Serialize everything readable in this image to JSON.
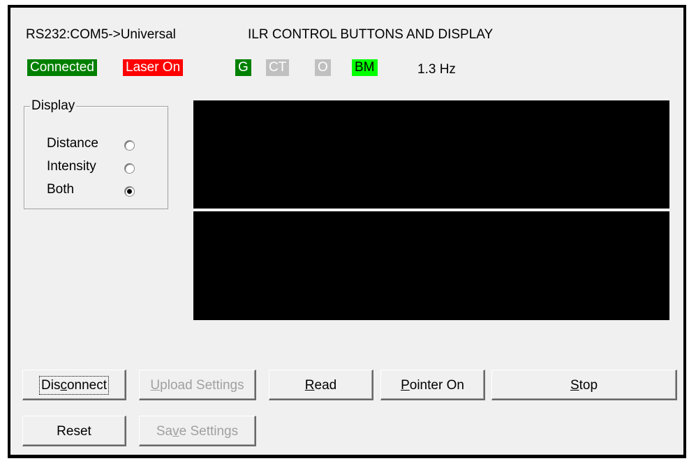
{
  "header": {
    "connection_info": "RS232:COM5->Universal",
    "title": "ILR CONTROL BUTTONS AND DISPLAY",
    "frequency": "1.3 Hz"
  },
  "status": {
    "connected": {
      "label": "Connected",
      "bg": "#008000",
      "fg": "#ffffff"
    },
    "laser": {
      "label": "Laser On",
      "bg": "#ff0000",
      "fg": "#ffffff"
    },
    "g": {
      "label": "G",
      "bg": "#008000",
      "fg": "#ffffff"
    },
    "ct": {
      "label": "CT",
      "bg": "#c0c0c0",
      "fg": "#ffffff"
    },
    "o": {
      "label": "O",
      "bg": "#c0c0c0",
      "fg": "#ffffff"
    },
    "bm": {
      "label": "BM",
      "bg": "#00ff00",
      "fg": "#000000"
    }
  },
  "display_group": {
    "title": "Display",
    "options": [
      {
        "label": "Distance",
        "selected": false
      },
      {
        "label": "Intensity",
        "selected": false
      },
      {
        "label": "Both",
        "selected": true
      }
    ]
  },
  "buttons": {
    "disconnect": {
      "pre": "Dis",
      "ul": "c",
      "post": "onnect"
    },
    "upload": {
      "pre": "",
      "ul": "U",
      "post": "pload Settings"
    },
    "read": {
      "pre": "",
      "ul": "R",
      "post": "ead"
    },
    "pointer": {
      "pre": "",
      "ul": "P",
      "post": "ointer On"
    },
    "stop": {
      "pre": "",
      "ul": "S",
      "post": "top"
    },
    "reset": {
      "pre": "Reset",
      "ul": "",
      "post": ""
    },
    "save": {
      "pre": "Sa",
      "ul": "v",
      "post": "e Settings"
    }
  }
}
